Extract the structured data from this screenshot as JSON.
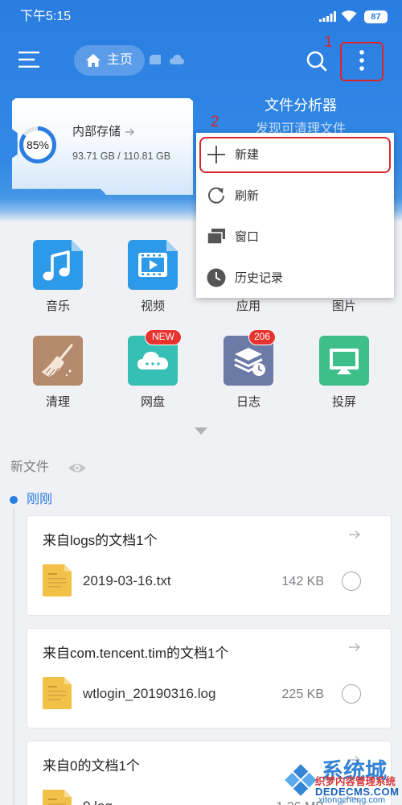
{
  "status_bar": {
    "time": "下午5:15",
    "battery": "87"
  },
  "app_bar": {
    "breadcrumb": "主页",
    "step_1": "1"
  },
  "storage": {
    "title": "内部存储",
    "percent": 85,
    "percent_label": "85%",
    "usage": "93.71 GB / 110.81 GB"
  },
  "analyzer": {
    "title": "文件分析器",
    "subtitle": "发现可清理文件"
  },
  "menu": {
    "step_2": "2",
    "items": [
      {
        "label": "新建",
        "icon": "plus-icon"
      },
      {
        "label": "刷新",
        "icon": "refresh-icon"
      },
      {
        "label": "窗口",
        "icon": "windows-icon"
      },
      {
        "label": "历史记录",
        "icon": "history-clock-icon"
      }
    ]
  },
  "categories": [
    {
      "label": "音乐",
      "icon": "music-note-icon",
      "color": "#2d9ae9"
    },
    {
      "label": "视频",
      "icon": "video-play-icon",
      "color": "#2d9ae9"
    },
    {
      "label": "应用"
    },
    {
      "label": "图片"
    },
    {
      "label": "清理",
      "icon": "broom-icon",
      "color": "#b4896c"
    },
    {
      "label": "网盘",
      "icon": "cloud-icon",
      "color": "#36bfb4",
      "badge": "NEW"
    },
    {
      "label": "日志",
      "icon": "log-stack-icon",
      "color": "#6b7aa6",
      "badge": "206"
    },
    {
      "label": "投屏",
      "icon": "screencast-icon",
      "color": "#3ebf8a"
    }
  ],
  "recent": {
    "title": "新文件",
    "time_group": "刚刚",
    "groups": [
      {
        "title": "来自logs的文档1个",
        "file": "2019-03-16.txt",
        "size": "142 KB"
      },
      {
        "title": "来自com.tencent.tim的文档1个",
        "file": "wtlogin_20190316.log",
        "size": "225 KB"
      },
      {
        "title": "来自0的文档1个",
        "file": "0.log",
        "size": "1.26 MB"
      }
    ]
  },
  "colors": {
    "accent": "#2b7de1",
    "annotation_red": "#d8262c",
    "badge_red": "#e8332f"
  },
  "watermark": {
    "cn": "系统城",
    "url": "xitongcheng.com",
    "cms_cn": "织梦内容管理系统",
    "cms_en": "DEDECMS.COM"
  }
}
